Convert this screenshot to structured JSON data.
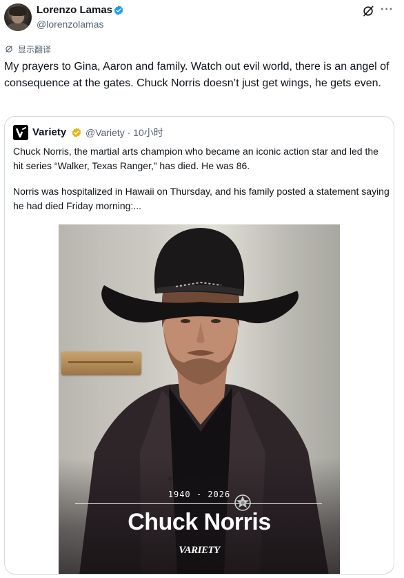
{
  "author": {
    "display_name": "Lorenzo Lamas",
    "handle": "@lorenzolamas"
  },
  "icons": {
    "verified": "verified-badge-icon",
    "grok": "grok-icon",
    "more": "more-icon",
    "translate": "translate-icon",
    "variety_logo": "variety-logo-icon",
    "gold_check": "gold-verified-icon",
    "star": "sheriff-star-icon"
  },
  "colors": {
    "verified_blue": "#1d9bf0",
    "gold": "#e2b719",
    "muted_text": "#536471",
    "border": "#cfd9de"
  },
  "translate_label": "显示翻译",
  "tweet_text": "My prayers to Gina, Aaron and family. Watch out evil world,  there is an angel of consequence at the gates. Chuck Norris doesn’t just get wings, he gets even.",
  "more_label": "···",
  "quote": {
    "name": "Variety",
    "handle_time": "@Variety · 10小时",
    "paragraph1": "Chuck Norris, the martial arts champion who became an iconic action star and led the hit series “Walker, Texas Ranger,” has died. He was 86.",
    "paragraph2": "Norris was hospitalized in Hawaii on Thursday, and his family posted a statement saying he had died Friday morning:...",
    "image": {
      "years": "1940 - 2026",
      "name": "Chuck Norris",
      "brand": "VARIETY"
    }
  }
}
